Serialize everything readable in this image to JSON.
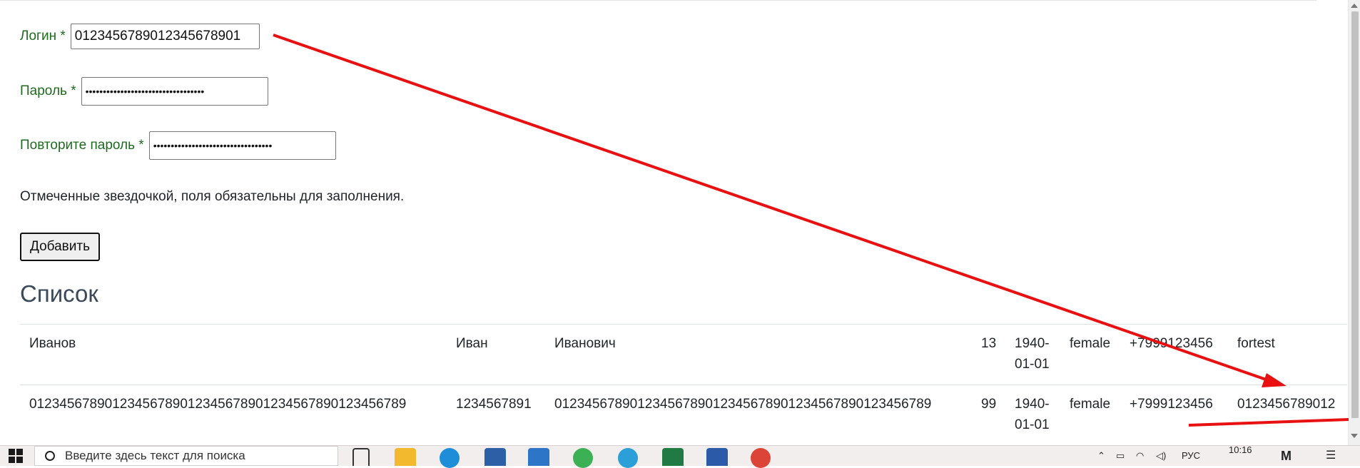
{
  "form": {
    "login_label": "Логин *",
    "login_value": "0123456789012345678901",
    "password_label": "Пароль *",
    "password_value": "••••••••••••••••••••••••••••••••••",
    "repeat_label": "Повторите пароль *",
    "repeat_value": "••••••••••••••••••••••••••••••••••",
    "required_note": "Отмеченные звездочкой, поля обязательны для заполнения.",
    "submit_label": "Добавить"
  },
  "list": {
    "heading": "Список",
    "rows": [
      {
        "last_name": "Иванов",
        "first_name": "Иван",
        "middle_name": "Иванович",
        "age": "13",
        "birth_date_1": "1940-",
        "birth_date_2": "01-01",
        "gender": "female",
        "phone": "+7999123456",
        "login": "fortest"
      },
      {
        "last_name": "01234567890123456789012345678901234567890123456789",
        "first_name": "1234567891",
        "middle_name": "01234567890123456789012345678901234567890123456789",
        "age": "99",
        "birth_date_1": "1940-",
        "birth_date_2": "01-01",
        "gender": "female",
        "phone": "+7999123456",
        "login": "0123456789012"
      }
    ]
  },
  "annotation": {
    "color": "#e81010"
  },
  "taskbar": {
    "search_placeholder": "Введите здесь текст для поиска",
    "language": "РУС",
    "time": "10:16",
    "apps": [
      "task-view-icon",
      "file-explorer-icon",
      "edge-icon",
      "store-icon",
      "mail-icon",
      "maps-icon",
      "telegram-icon",
      "excel-icon",
      "word-icon",
      "chrome-icon"
    ]
  }
}
